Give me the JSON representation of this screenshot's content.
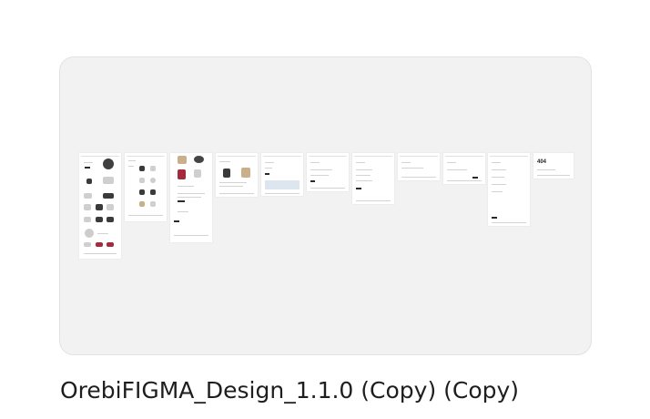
{
  "file": {
    "name": "OrebiFIGMA_Design_1.1.0 (Copy) (Copy)"
  },
  "thumbnail": {
    "background": "#f2f2f2",
    "frames": [
      {
        "id": "home",
        "text": ""
      },
      {
        "id": "shop",
        "text": ""
      },
      {
        "id": "product",
        "text": ""
      },
      {
        "id": "cart",
        "text": ""
      },
      {
        "id": "contact",
        "text": ""
      },
      {
        "id": "about",
        "text": ""
      },
      {
        "id": "checkout",
        "text": ""
      },
      {
        "id": "journal",
        "text": ""
      },
      {
        "id": "offers",
        "text": ""
      },
      {
        "id": "account",
        "text": ""
      },
      {
        "id": "not-found",
        "text": "404"
      }
    ]
  }
}
